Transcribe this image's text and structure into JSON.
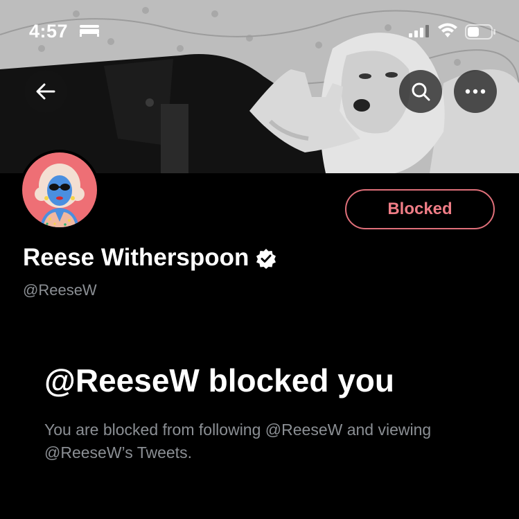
{
  "status_bar": {
    "time": "4:57",
    "icons": [
      "bed-icon",
      "signal-icon",
      "wifi-icon",
      "battery-icon"
    ]
  },
  "header": {
    "back_icon": "arrow-left-icon",
    "search_icon": "search-icon",
    "more_icon": "more-icon"
  },
  "profile": {
    "name": "Reese Witherspoon",
    "handle": "@ReeseW",
    "verified_icon": "verified-badge-icon",
    "action_button": "Blocked"
  },
  "blocked_notice": {
    "title": "@ReeseW blocked you",
    "description": "You are blocked from following @ReeseW and viewing @ReeseW’s Tweets."
  },
  "colors": {
    "background": "#000000",
    "blocked_accent": "#ef7d86",
    "secondary_text": "#8b8f94"
  }
}
